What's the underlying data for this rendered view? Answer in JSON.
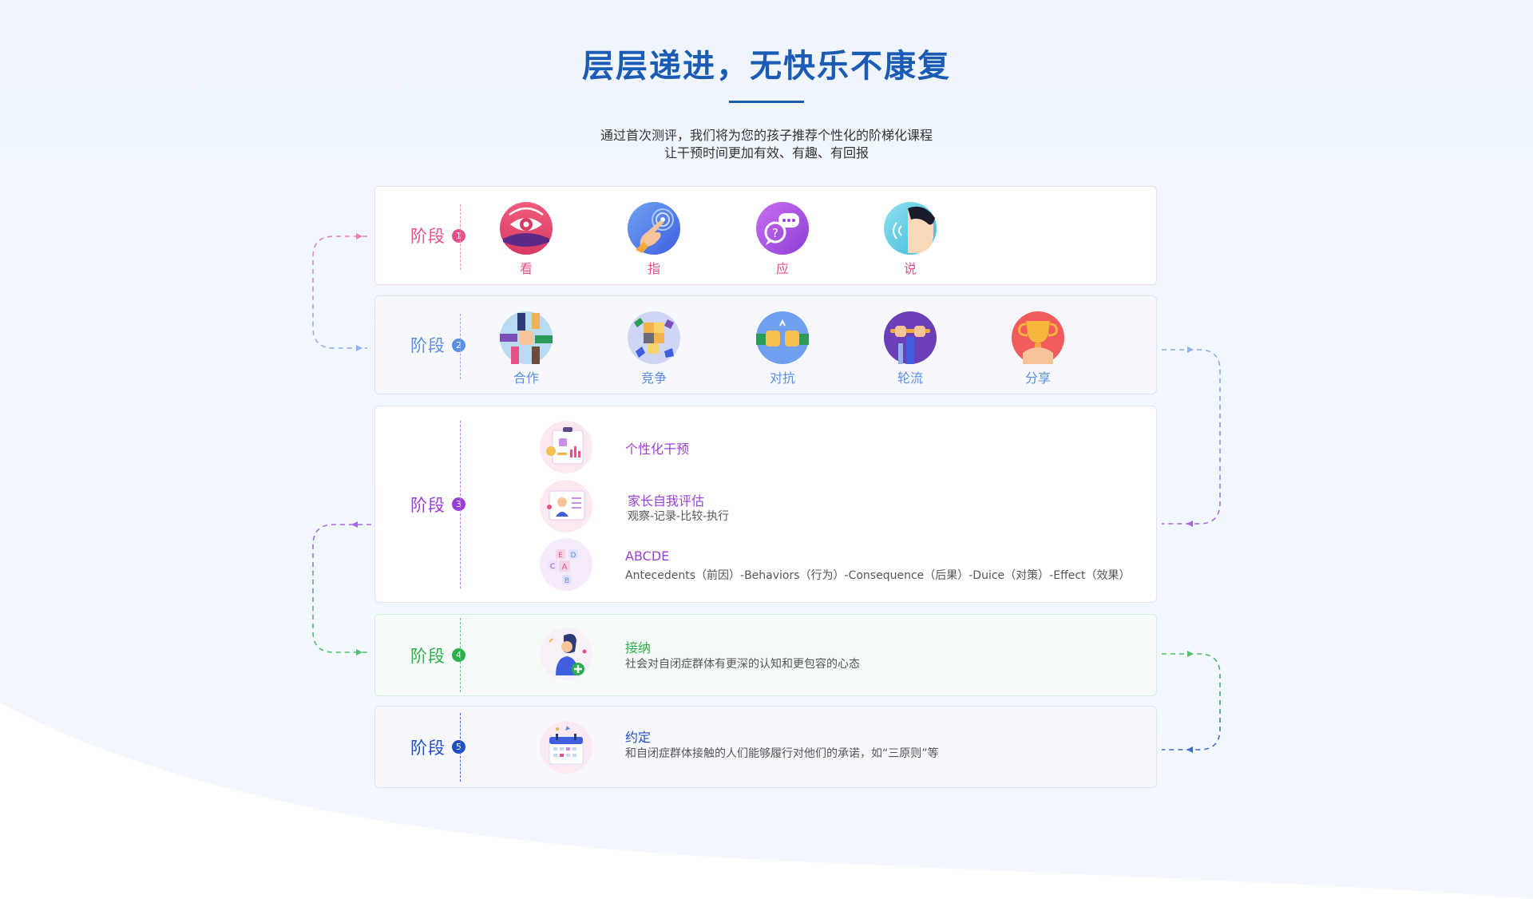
{
  "header": {
    "title": "层层递进，无快乐不康复",
    "subtitle_line1": "通过首次测评，我们将为您的孩子推荐个性化的阶梯化课程",
    "subtitle_line2": "让干预时间更加有效、有趣、有回报"
  },
  "stages": [
    {
      "label": "阶段",
      "number": "1",
      "color": "#e8508a",
      "items": [
        {
          "label": "看",
          "icon": "eye-icon"
        },
        {
          "label": "指",
          "icon": "pointing-finger-icon"
        },
        {
          "label": "应",
          "icon": "speech-bubble-icon"
        },
        {
          "label": "说",
          "icon": "speaking-head-icon"
        }
      ]
    },
    {
      "label": "阶段",
      "number": "2",
      "color": "#5b8ee6",
      "items": [
        {
          "label": "合作",
          "icon": "handshake-icon"
        },
        {
          "label": "竞争",
          "icon": "puzzle-icon"
        },
        {
          "label": "对抗",
          "icon": "fists-icon"
        },
        {
          "label": "轮流",
          "icon": "relay-baton-icon"
        },
        {
          "label": "分享",
          "icon": "trophy-icon"
        }
      ]
    },
    {
      "label": "阶段",
      "number": "3",
      "color": "#9b3fd9",
      "rows": [
        {
          "title": "个性化干预",
          "desc": "",
          "icon": "report-chart-icon"
        },
        {
          "title": "家长自我评估",
          "desc": "观察-记录-比较-执行",
          "icon": "parent-profile-icon"
        },
        {
          "title": "ABCDE",
          "desc": "Antecedents（前因）-Behaviors（行为）-Consequence（后果）-Duice（对策）-Effect（效果）",
          "icon": "letter-blocks-icon"
        }
      ]
    },
    {
      "label": "阶段",
      "number": "4",
      "color": "#2ab04a",
      "rows": [
        {
          "title": "接纳",
          "desc": "社会对自闭症群体有更深的认知和更包容的心态",
          "icon": "person-add-icon"
        }
      ]
    },
    {
      "label": "阶段",
      "number": "5",
      "color": "#1f4fc4",
      "rows": [
        {
          "title": "约定",
          "desc": "和自闭症群体接触的人们能够履行对他们的承诺，如“三原则”等",
          "icon": "calendar-icon"
        }
      ]
    }
  ]
}
